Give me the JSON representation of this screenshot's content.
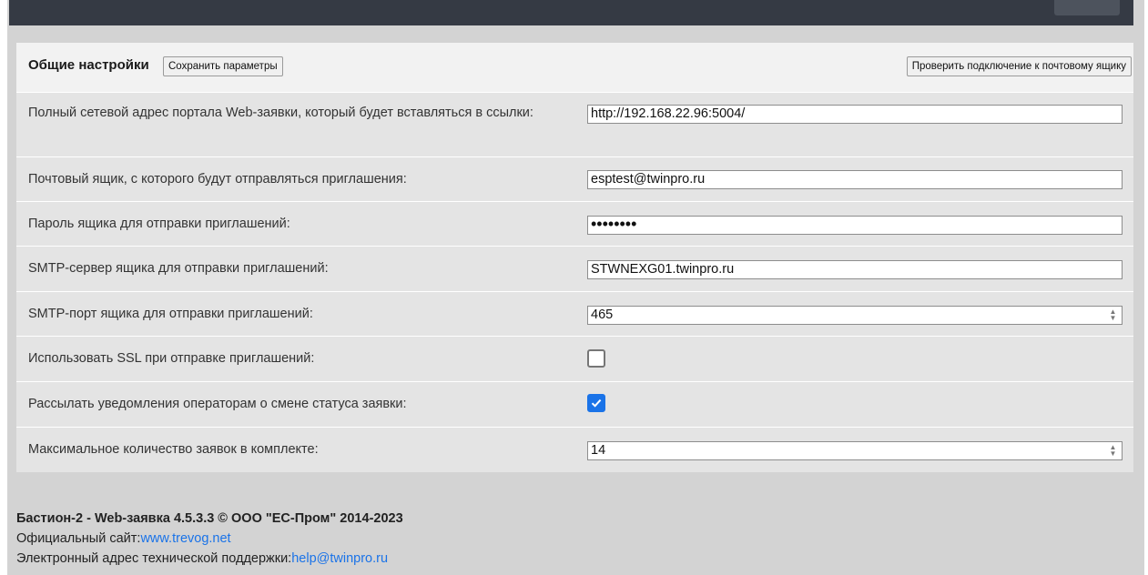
{
  "header": {
    "title": "Общие настройки",
    "save_button": "Сохранить параметры",
    "check_button": "Проверить подключение к почтовому ящику"
  },
  "settings": [
    {
      "label": "Полный сетевой адрес портала Web-заявки, который будет вставляться в ссылки:",
      "value": "http://192.168.22.96:5004/"
    },
    {
      "label": "Почтовый ящик, с которого будут отправляться приглашения:",
      "value": "esptest@twinpro.ru"
    },
    {
      "label": "Пароль ящика для отправки приглашений:",
      "value": "••••••••"
    },
    {
      "label": "SMTP-сервер ящика для отправки приглашений:",
      "value": "STWNEXG01.twinpro.ru"
    },
    {
      "label": "SMTP-порт ящика для отправки приглашений:",
      "value": "465"
    },
    {
      "label": "Использовать SSL при отправке приглашений:",
      "checked": false
    },
    {
      "label": "Рассылать уведомления операторам о смене статуса заявки:",
      "checked": true
    },
    {
      "label": "Максимальное количество заявок в комплекте:",
      "value": "14"
    }
  ],
  "footer": {
    "copyright": "Бастион-2 - Web-заявка 4.5.3.3 © ООО \"ЕС-Пром\" 2014-2023",
    "site_label": "Официальный сайт:",
    "site_link": "www.trevog.net",
    "support_label": "Электронный адрес технической поддержки:",
    "support_link": "help@twinpro.ru"
  },
  "colors": {
    "accent": "#1a73e8",
    "topbar": "#353a44",
    "background": "#d3d3d3"
  }
}
